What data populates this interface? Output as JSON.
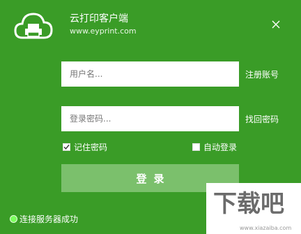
{
  "header": {
    "title": "云打印客户端",
    "subtitle": "www.eyprint.com",
    "logo_icon": "cloud-printer-icon",
    "close_icon": "close-icon"
  },
  "form": {
    "username_placeholder": "用户名...",
    "password_placeholder": "登录密码...",
    "register_link": "注册账号",
    "retrieve_link": "找回密码",
    "remember_label": "记住密码",
    "remember_checked": true,
    "auto_login_label": "自动登录",
    "auto_login_checked": false,
    "login_button": "登录"
  },
  "status": {
    "text": "连接服务器成功",
    "indicator_color": "#7bff5d"
  },
  "watermark": {
    "text": "下载吧",
    "url": "www.xiazaiba.com"
  },
  "colors": {
    "background": "#3a9c27",
    "button": "#7bc06c"
  }
}
